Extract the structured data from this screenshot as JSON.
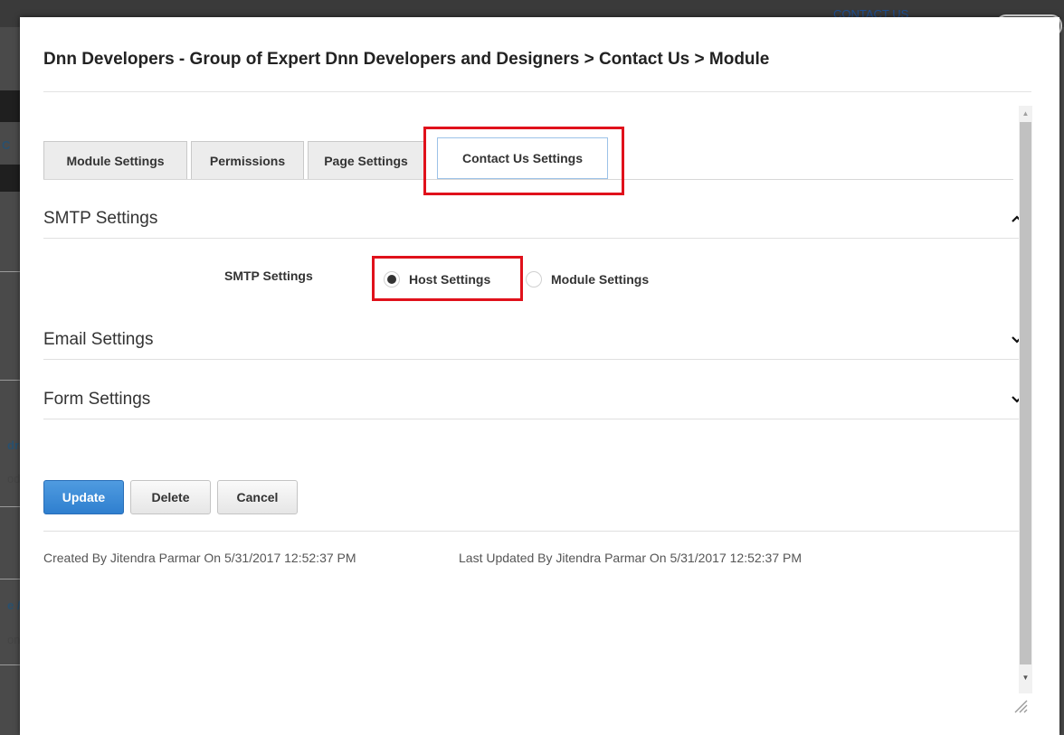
{
  "background": {
    "top_link": "CONTACT US",
    "fragments": [
      "C",
      "dre",
      "odd",
      "e /",
      "one"
    ]
  },
  "dialog": {
    "title": "Dnn Developers - Group of Expert Dnn Developers and Designers > Contact Us > Module",
    "window_controls": {
      "maximize_icon": "expand-icon",
      "close_icon": "close-icon"
    }
  },
  "tabs": [
    {
      "label": "Module Settings",
      "active": false
    },
    {
      "label": "Permissions",
      "active": false
    },
    {
      "label": "Page Settings",
      "active": false
    },
    {
      "label": "Contact Us Settings",
      "active": true
    }
  ],
  "sections": {
    "smtp": {
      "title": "SMTP Settings",
      "expanded": true,
      "chevron": "chevron-up-icon"
    },
    "email": {
      "title": "Email Settings",
      "expanded": false,
      "chevron": "chevron-down-icon"
    },
    "form": {
      "title": "Form Settings",
      "expanded": false,
      "chevron": "chevron-down-icon"
    }
  },
  "smtp_field": {
    "label": "SMTP Settings",
    "options": [
      {
        "label": "Host Settings",
        "selected": true
      },
      {
        "label": "Module Settings",
        "selected": false
      }
    ]
  },
  "actions": {
    "update": "Update",
    "delete": "Delete",
    "cancel": "Cancel"
  },
  "meta": {
    "created": "Created By Jitendra Parmar On 5/31/2017 12:52:37 PM",
    "updated": "Last Updated By Jitendra Parmar On 5/31/2017 12:52:37 PM"
  },
  "colors": {
    "highlight": "#e0111b",
    "primary_button": "#2f7fcf"
  }
}
